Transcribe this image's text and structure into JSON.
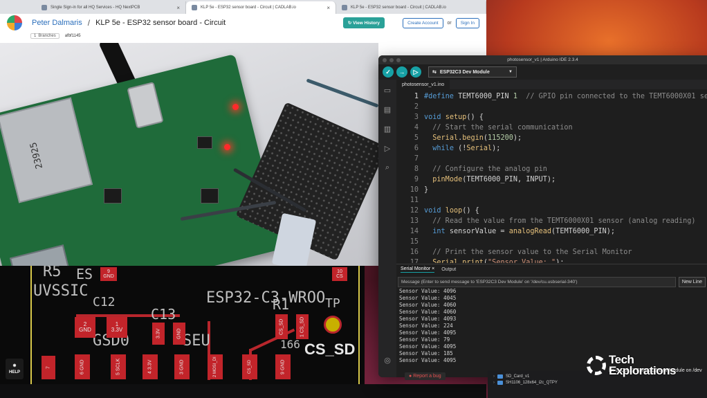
{
  "browser": {
    "tabs": [
      {
        "label": "Single Sign-in for all HQ Services - HQ NextPCB"
      },
      {
        "label": "KLP 5e - ESP32 sensor board - Circuit | CADLAB.io"
      },
      {
        "label": "KLP 5e - ESP32 sensor board - Circuit | CADLAB.io"
      }
    ],
    "close_glyph": "×"
  },
  "cadlab": {
    "user": "Peter Dalmaris",
    "separator": "/",
    "project": "KLP 5e - ESP32 sensor board - Circuit",
    "view_history": "View History",
    "create_account": "Create Account",
    "or": "or",
    "sign_in": "Sign In",
    "branches_count": "1",
    "branches_label": "Branches",
    "commit": "afbf1145",
    "help": "HELP",
    "report_bug": "Report a bug"
  },
  "photo": {
    "sd_text": "23925"
  },
  "pcb": {
    "silk": [
      "R5",
      "ES",
      "UVSSIC",
      "C12",
      "C13",
      "ESP32-C3-WROO",
      "R1",
      "TP",
      "GSD0",
      "SEU",
      "CS_SD",
      "166"
    ],
    "pads": [
      {
        "label": "9\nGND"
      },
      {
        "label": "10\nCS"
      },
      {
        "label": "2\nGND"
      },
      {
        "label": "1\n3.3V"
      },
      {
        "label": "3.3V"
      },
      {
        "label": "GND"
      },
      {
        "label": "CS_SD"
      },
      {
        "label": "1\nCS_SD"
      },
      {
        "label": "7"
      },
      {
        "label": "6\nGND"
      },
      {
        "label": "5\nSCLK"
      },
      {
        "label": "4\n3.3V"
      },
      {
        "label": "3\nGND"
      },
      {
        "label": "2\nMOSI_DI"
      },
      {
        "label": "CS_SD"
      },
      {
        "label": "9\nGND"
      },
      {
        "label": "TP"
      }
    ]
  },
  "ide": {
    "window_title": "photosensor_v1 | Arduino IDE 2.3.4",
    "board": "ESP32C3 Dev Module",
    "file_tab": "photosensor_v1.ino",
    "code_lines": [
      {
        "n": "1",
        "text": "#define TEMT6000_PIN 1  // GPIO pin connected to the TEMT6000X01 se"
      },
      {
        "n": "2",
        "text": ""
      },
      {
        "n": "3",
        "text": "void setup() {"
      },
      {
        "n": "4",
        "text": "  // Start the serial communication"
      },
      {
        "n": "5",
        "text": "  Serial.begin(115200);"
      },
      {
        "n": "6",
        "text": "  while (!Serial);"
      },
      {
        "n": "7",
        "text": ""
      },
      {
        "n": "8",
        "text": "  // Configure the analog pin"
      },
      {
        "n": "9",
        "text": "  pinMode(TEMT6000_PIN, INPUT);"
      },
      {
        "n": "10",
        "text": "}"
      },
      {
        "n": "11",
        "text": ""
      },
      {
        "n": "12",
        "text": "void loop() {"
      },
      {
        "n": "13",
        "text": "  // Read the value from the TEMT6000X01 sensor (analog reading)"
      },
      {
        "n": "14",
        "text": "  int sensorValue = analogRead(TEMT6000_PIN);"
      },
      {
        "n": "15",
        "text": ""
      },
      {
        "n": "16",
        "text": "  // Print the sensor value to the Serial Monitor"
      },
      {
        "n": "17",
        "text": "  Serial.print(\"Sensor Value: \");"
      }
    ],
    "serial_monitor_tab": "Serial Monitor",
    "output_tab": "Output",
    "serial_placeholder": "Message (Enter to send message to 'ESP32C3 Dev Module' on '/dev/cu.usbserial-340')",
    "new_line": "New Line",
    "serial_lines": [
      "Sensor Value: 4096",
      "Sensor Value: 4045",
      "Sensor Value: 4060",
      "Sensor Value: 4060",
      "Sensor Value: 4093",
      "Sensor Value: 224",
      "Sensor Value: 4095",
      "Sensor Value: 79",
      "Sensor Value: 4095",
      "Sensor Value: 185",
      "Sensor Value: 4095"
    ],
    "status": "Ln 1, Col 23    ESP32C3 Dev Module on /dev"
  },
  "finder": {
    "items": [
      "SD_Card_v1",
      "SH1106_128x64_i2c_QTPY"
    ]
  },
  "watermark": {
    "line1": "Tech",
    "line2": "Explorations"
  },
  "colors": {
    "accent": "#17a1a5",
    "pad_red": "#c2242a",
    "board_outline": "#d8c84a"
  }
}
